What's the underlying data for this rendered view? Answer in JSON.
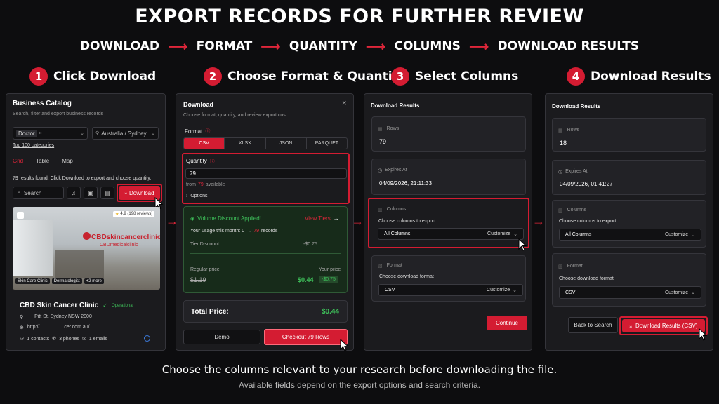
{
  "hero_title": "EXPORT RECORDS FOR FURTHER REVIEW",
  "flow": [
    "DOWNLOAD",
    "FORMAT",
    "QUANTITY",
    "COLUMNS",
    "DOWNLOAD RESULTS"
  ],
  "steps": [
    {
      "num": "1",
      "title": "Click Download"
    },
    {
      "num": "2",
      "title": "Choose Format & Quantity"
    },
    {
      "num": "3",
      "title": "Select Columns"
    },
    {
      "num": "4",
      "title": "Download Results"
    }
  ],
  "p1": {
    "title": "Business Catalog",
    "subtitle": "Search, filter and export business records",
    "chip": "Doctor",
    "location": "Australia / Sydney",
    "link": "Top 100 categories",
    "tabs": [
      "Grid",
      "Table",
      "Map"
    ],
    "results": "79 results found. Click Download to export and choose quantity.",
    "search": "Search",
    "download": "Download",
    "rating": "4.9 (198 reviews)",
    "sign1": "CBDskincancerclinic",
    "sign2": "CBDmedicalclinic",
    "tags": [
      "Skin Care Clinic",
      "Dermatologist",
      "+2 more"
    ],
    "name": "CBD Skin Cancer Clinic",
    "status": "Operational",
    "address": "Pitt St, Sydney NSW 2000",
    "web1": "http://",
    "web2": "cer.com.au/",
    "contacts": "1 contacts",
    "phones": "3 phones",
    "emails": "1 emails"
  },
  "p2": {
    "title": "Download",
    "subtitle": "Choose format, quantity, and review export cost.",
    "format_label": "Format",
    "formats": [
      "CSV",
      "XLSX",
      "JSON",
      "PARQUET"
    ],
    "qty_label": "Quantity",
    "qty_value": "79",
    "from": "from",
    "avail_num": "79",
    "available": "available",
    "options": "Options",
    "discount_title": "Volume Discount Applied!",
    "view_tiers": "View Tiers",
    "usage_pre": "Your usage this month: 0",
    "usage_num": "79",
    "usage_post": "records",
    "tier_label": "Tier Discount:",
    "tier_value": "-$0.75",
    "regular_label": "Regular price",
    "regular_value": "$1.19",
    "your_label": "Your price",
    "your_value": "$0.44",
    "badge": "-$0.75",
    "total_label": "Total Price:",
    "total_value": "$0.44",
    "demo": "Demo",
    "checkout": "Checkout 79 Rows"
  },
  "p3": {
    "title": "Download Results",
    "rows_label": "Rows",
    "rows_value": "79",
    "expires_label": "Expires At",
    "expires_value": "04/09/2026, 21:11:33",
    "columns_label": "Columns",
    "choose_cols": "Choose columns to export",
    "all_columns": "All Columns",
    "customize": "Customize",
    "format_label": "Format",
    "choose_fmt": "Choose download format",
    "fmt_value": "CSV",
    "continue": "Continue"
  },
  "p4": {
    "title": "Download Results",
    "rows_label": "Rows",
    "rows_value": "18",
    "expires_label": "Expires At",
    "expires_value": "04/09/2026, 01:41:27",
    "columns_label": "Columns",
    "choose_cols": "Choose columns to export",
    "all_columns": "All Columns",
    "customize": "Customize",
    "format_label": "Format",
    "choose_fmt": "Choose download format",
    "fmt_value": "CSV",
    "back": "Back to Search",
    "download": "Download Results (CSV)"
  },
  "footer_main": "Choose the columns relevant to your  research before downloading the file.",
  "footer_sub": "Available fields depend on the export options and search criteria.",
  "colors": {
    "accent": "#d41c32",
    "green": "#3ec15a",
    "bg": "#0d0d0f",
    "panel": "#1b1b1e"
  }
}
